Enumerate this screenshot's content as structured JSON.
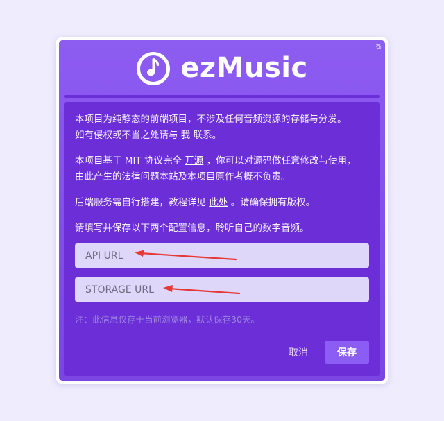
{
  "app": {
    "title": "ezMusic"
  },
  "icons": {
    "logo": "music-note-icon",
    "settings": "gear-icon"
  },
  "colors": {
    "page_background": "#efedfd",
    "dialog_purple": "#7a45e2",
    "content_purple": "#6c2ed6",
    "field_background": "#ded7fa",
    "save_button": "#8c5df4",
    "arrow_red": "#e53935"
  },
  "intro": {
    "line1": "本项目为纯静态的前端项目，不涉及任何音频资源的存储与分发。",
    "line2_pre": "如有侵权或不当之处请与",
    "line2_link": "我",
    "line2_post": "联系。"
  },
  "license": {
    "line1_pre": "本项目基于 MIT 协议完全",
    "line1_link": "开源",
    "line1_post": "，你可以对源码做任意修改与使用，",
    "line2": "由此产生的法律问题本站及本项目原作者概不负责。"
  },
  "backend": {
    "pre": "后端服务需自行搭建，教程详见",
    "link": "此处",
    "post": "。请确保拥有版权。"
  },
  "instruction": "请填写并保存以下两个配置信息，聆听自己的数字音频。",
  "form": {
    "api_placeholder": "API URL",
    "api_value": "",
    "storage_placeholder": "STORAGE URL",
    "storage_value": ""
  },
  "note": "注：此信息仅存于当前浏览器，默认保存30天。",
  "actions": {
    "cancel_label": "取消",
    "save_label": "保存"
  }
}
